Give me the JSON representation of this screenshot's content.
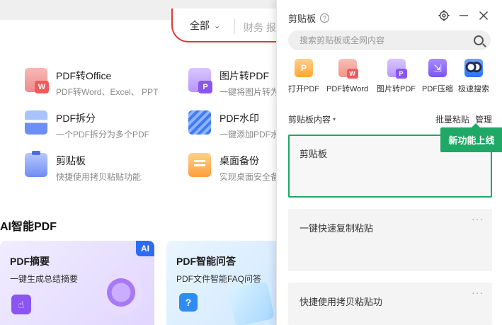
{
  "background": {
    "search": {
      "scope": "全部",
      "hint": "财务 报"
    },
    "tools": [
      {
        "title": "PDF转Office",
        "desc": "PDF转Word、Excel、 PPT"
      },
      {
        "title": "图片转PDF",
        "desc": "一键将图片转为"
      },
      {
        "title": "PDF拆分",
        "desc": "一个PDF拆分为多个PDF"
      },
      {
        "title": "PDF水印",
        "desc": "一键添加PDF水"
      },
      {
        "title": "剪贴板",
        "desc": "快捷使用拷贝粘贴功能"
      },
      {
        "title": "桌面备份",
        "desc": "实现桌面安全备"
      }
    ],
    "ai_section_title": "AI智能PDF",
    "cards": [
      {
        "title": "PDF摘要",
        "desc": "一键生成总结摘要",
        "badge": "AI"
      },
      {
        "title": "PDF智能问答",
        "desc": "PDF文件智能FAQ问答"
      }
    ]
  },
  "panel": {
    "title": "剪贴板",
    "help_icon": "?",
    "search_placeholder": "搜索剪贴板或全网内容",
    "quick_actions": [
      {
        "label": "打开PDF",
        "icon": "open-pdf-icon"
      },
      {
        "label": "PDF转Word",
        "icon": "pdf-to-word-icon"
      },
      {
        "label": "图片转PDF",
        "icon": "image-to-pdf-icon"
      },
      {
        "label": "PDF压缩",
        "icon": "pdf-compress-icon"
      },
      {
        "label": "极速搜索",
        "icon": "fast-search-icon"
      }
    ],
    "content_dropdown": "剪贴板内容",
    "batch_paste": "批量粘贴",
    "manage": "管理",
    "new_feature_badge": "新功能上线",
    "items": [
      {
        "text": "剪贴板"
      },
      {
        "text": "一键快速复制粘贴"
      },
      {
        "text": "快捷使用拷贝粘贴功"
      }
    ],
    "more_glyph": "···",
    "colors": {
      "accent_green": "#1fa866",
      "brand_red": "#e03a3a",
      "ai_blue": "#2f6cf5"
    }
  }
}
